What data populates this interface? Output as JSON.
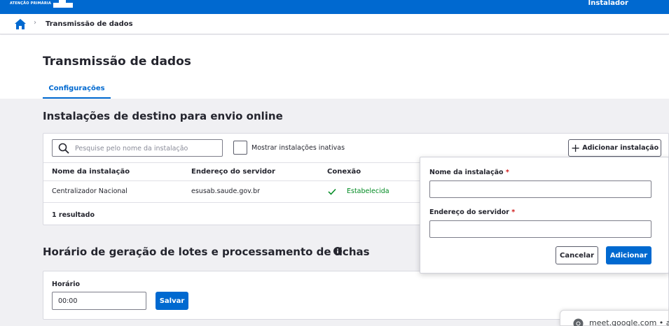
{
  "header": {
    "logo_text": "ATENÇÃO PRIMÁRIA",
    "user_role": "Instalador"
  },
  "breadcrumb": {
    "separator": "›",
    "current": "Transmissão de dados"
  },
  "page": {
    "title": "Transmissão de dados",
    "tabs": [
      {
        "label": "Configurações",
        "active": true
      }
    ]
  },
  "installations": {
    "section_title": "Instalações de destino para envio online",
    "search_placeholder": "Pesquise pelo nome da instalação",
    "show_inactive_label": "Mostrar instalações inativas",
    "show_inactive_checked": false,
    "add_button_label": "Adicionar instalação",
    "columns": [
      "Nome da instalação",
      "Endereço do servidor",
      "Conexão"
    ],
    "rows": [
      {
        "name": "Centralizador Nacional",
        "server": "esusab.saude.gov.br",
        "connection": "Estabelecida"
      }
    ],
    "result_count": "1 resultado"
  },
  "schedule": {
    "section_title": "Horário de geração de lotes e processamento de fichas",
    "field_label": "Horário",
    "value": "00:00",
    "save_label": "Salvar"
  },
  "popover": {
    "name_label": "Nome da instalação",
    "server_label": "Endereço do servidor",
    "required_marker": "*",
    "name_value": "",
    "server_value": "",
    "cancel_label": "Cancelar",
    "add_label": "Adicionar"
  },
  "browser_popup": {
    "text": "meet.google.com  •  a"
  },
  "colors": {
    "primary": "#0069d0",
    "success": "#008a22",
    "required": "#d01b1b"
  }
}
